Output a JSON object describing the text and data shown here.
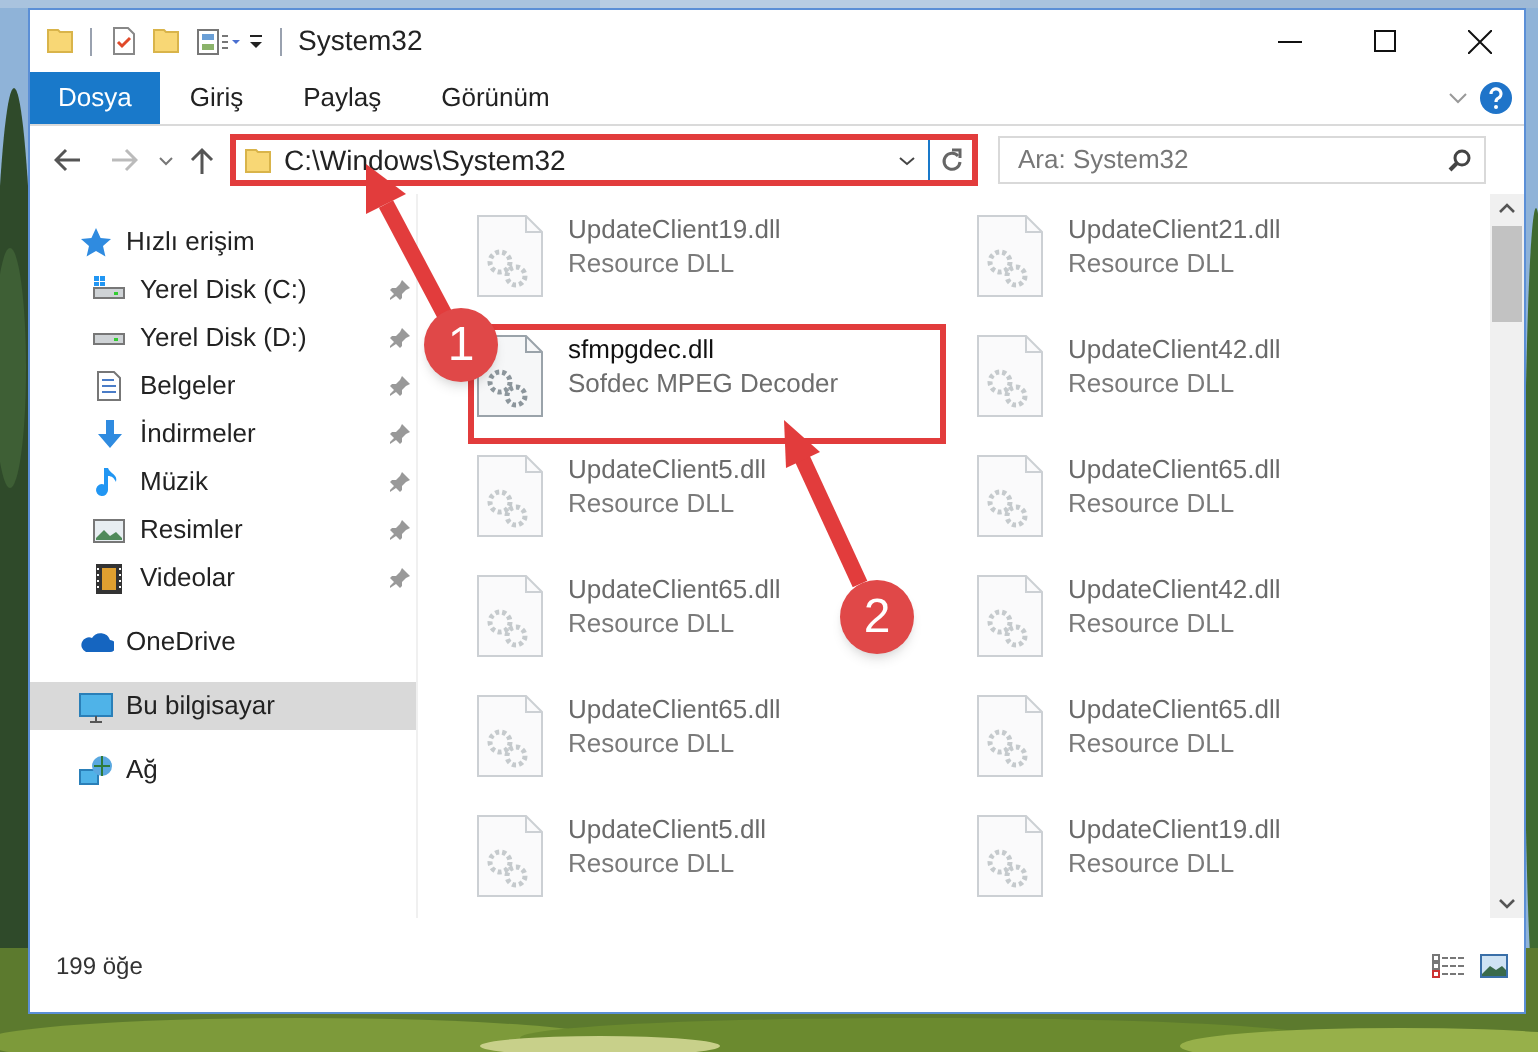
{
  "window": {
    "title": "System32"
  },
  "ribbon": {
    "tabs": [
      {
        "label": "Dosya",
        "selected": true
      },
      {
        "label": "Giriş",
        "selected": false
      },
      {
        "label": "Paylaş",
        "selected": false
      },
      {
        "label": "Görünüm",
        "selected": false
      }
    ]
  },
  "address_bar": {
    "path": "C:\\Windows\\System32",
    "highlighted": true
  },
  "search": {
    "placeholder": "Ara: System32"
  },
  "navigation": [
    {
      "label": "Hızlı erişim",
      "selected": false,
      "children": [
        {
          "label": "Yerel Disk (C:)",
          "pinned": true
        },
        {
          "label": "Yerel Disk (D:)",
          "pinned": true
        },
        {
          "label": "Belgeler",
          "pinned": true
        },
        {
          "label": "İndirmeler",
          "pinned": true
        },
        {
          "label": "Müzik",
          "pinned": true
        },
        {
          "label": "Resimler",
          "pinned": true
        },
        {
          "label": "Videolar",
          "pinned": true
        }
      ]
    },
    {
      "label": "OneDrive",
      "selected": false
    },
    {
      "label": "Bu bilgisayar",
      "selected": true
    },
    {
      "label": "Ağ",
      "selected": false
    }
  ],
  "files": [
    {
      "name": "UpdateClient19.dll",
      "type": "Resource DLL",
      "blurred": true,
      "highlighted": false
    },
    {
      "name": "UpdateClient21.dll",
      "type": "Resource DLL",
      "blurred": true,
      "highlighted": false
    },
    {
      "name": "sfmpgdec.dll",
      "type": "Sofdec MPEG Decoder",
      "blurred": false,
      "highlighted": true
    },
    {
      "name": "UpdateClient42.dll",
      "type": "Resource DLL",
      "blurred": true,
      "highlighted": false
    },
    {
      "name": "UpdateClient5.dll",
      "type": "Resource DLL",
      "blurred": true,
      "highlighted": false
    },
    {
      "name": "UpdateClient65.dll",
      "type": "Resource DLL",
      "blurred": true,
      "highlighted": false
    },
    {
      "name": "UpdateClient65.dll",
      "type": "Resource DLL",
      "blurred": true,
      "highlighted": false
    },
    {
      "name": "UpdateClient42.dll",
      "type": "Resource DLL",
      "blurred": true,
      "highlighted": false
    },
    {
      "name": "UpdateClient65.dll",
      "type": "Resource DLL",
      "blurred": true,
      "highlighted": false
    },
    {
      "name": "UpdateClient65.dll",
      "type": "Resource DLL",
      "blurred": true,
      "highlighted": false
    },
    {
      "name": "UpdateClient5.dll",
      "type": "Resource DLL",
      "blurred": true,
      "highlighted": false
    },
    {
      "name": "UpdateClient19.dll",
      "type": "Resource DLL",
      "blurred": true,
      "highlighted": false
    }
  ],
  "status_bar": {
    "item_count": "199 öğe"
  },
  "annotations": [
    {
      "number": "1"
    },
    {
      "number": "2"
    }
  ]
}
